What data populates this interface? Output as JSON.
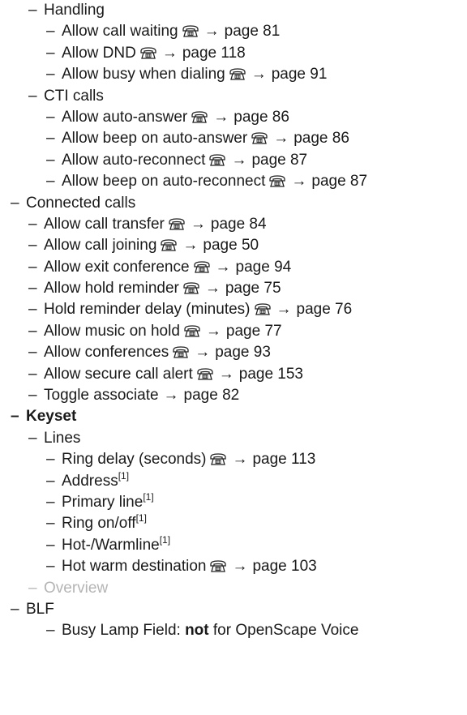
{
  "dash": "–",
  "arrow": "→",
  "sup": "[1]",
  "rows": [
    {
      "level": 1,
      "label": "Handling"
    },
    {
      "level": 2,
      "label": "Allow call waiting",
      "phone": true,
      "page": "page 81"
    },
    {
      "level": 2,
      "label": "Allow DND",
      "phone": true,
      "page": "page 118"
    },
    {
      "level": 2,
      "label": "Allow busy when dialing",
      "phone": true,
      "page": "page 91"
    },
    {
      "level": 1,
      "label": "CTI calls"
    },
    {
      "level": 2,
      "label": "Allow auto-answer",
      "phone": true,
      "page": "page 86"
    },
    {
      "level": 2,
      "label": "Allow beep on auto-answer",
      "phone": true,
      "page": "page 86"
    },
    {
      "level": 2,
      "label": "Allow auto-reconnect",
      "phone": true,
      "page": "page 87"
    },
    {
      "level": 2,
      "label": "Allow beep on auto-reconnect",
      "phone": true,
      "page": "page 87"
    },
    {
      "level": 0,
      "label": "Connected calls"
    },
    {
      "level": 1,
      "label": "Allow call transfer",
      "phone": true,
      "page": "page 84"
    },
    {
      "level": 1,
      "label": "Allow call joining",
      "phone": true,
      "page": "page 50"
    },
    {
      "level": 1,
      "label": "Allow exit conference",
      "phone": true,
      "page": "page 94"
    },
    {
      "level": 1,
      "label": "Allow hold reminder",
      "phone": true,
      "page": "page 75"
    },
    {
      "level": 1,
      "label": "Hold reminder delay (minutes)",
      "phone": true,
      "page": "page 76"
    },
    {
      "level": 1,
      "label": "Allow music on hold",
      "phone": true,
      "page": "page 77"
    },
    {
      "level": 1,
      "label": "Allow conferences",
      "phone": true,
      "page": "page 93"
    },
    {
      "level": 1,
      "label": "Allow secure call alert",
      "phone": true,
      "page": "page 153"
    },
    {
      "level": 1,
      "label": "Toggle associate",
      "page": "page 82"
    },
    {
      "level": 0,
      "label": "Keyset",
      "bold": true
    },
    {
      "level": 1,
      "label": "Lines"
    },
    {
      "level": 2,
      "label": "Ring delay (seconds)",
      "phone": true,
      "page": "page 113"
    },
    {
      "level": 2,
      "label": "Address",
      "footnote": true
    },
    {
      "level": 2,
      "label": "Primary line",
      "footnote": true
    },
    {
      "level": 2,
      "label": "Ring on/off",
      "footnote": true
    },
    {
      "level": 2,
      "label": "Hot-/Warmline",
      "footnote": true
    },
    {
      "level": 2,
      "label": "Hot warm destination",
      "phone": true,
      "page": "page 103"
    },
    {
      "level": 1,
      "label": "Overview",
      "grey": true
    },
    {
      "level": 0,
      "label": "BLF"
    },
    {
      "level": 2,
      "label_before": "Busy Lamp Field: ",
      "label_bold": "not",
      "label_after": " for OpenScape Voice"
    }
  ]
}
